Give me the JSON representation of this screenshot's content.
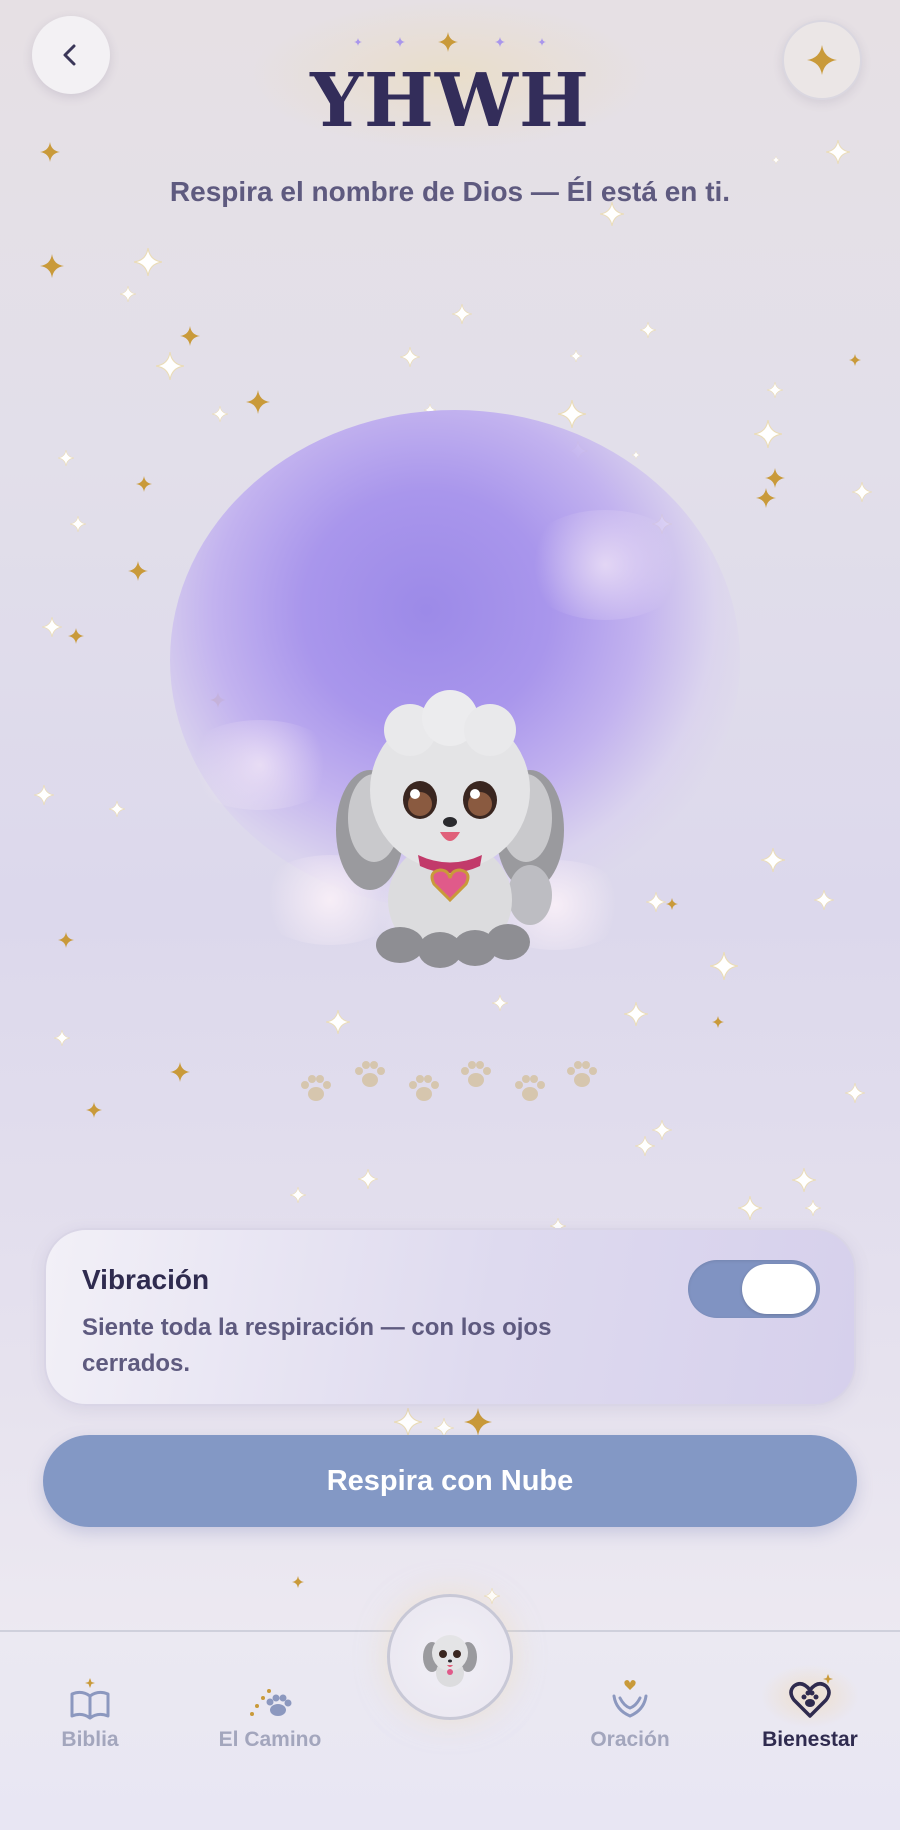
{
  "header": {
    "title": "YHWH",
    "subtitle": "Respira el nombre de Dios — Él está en ti.",
    "back_icon": "chevron-left-icon",
    "star_icon": "sparkle-icon"
  },
  "scene": {
    "mascot": "cloud-puppy-mascot",
    "paw_prints": 6
  },
  "vibration": {
    "title": "Vibración",
    "description": "Siente toda la respiración — con los ojos cerrados.",
    "enabled": true
  },
  "breathe_button": {
    "label": "Respira con Nube"
  },
  "tabbar": {
    "tabs": [
      {
        "label": "Biblia",
        "icon": "open-book-icon",
        "active": false
      },
      {
        "label": "El Camino",
        "icon": "paw-path-icon",
        "active": false
      },
      {
        "label": "",
        "icon": "puppy-avatar-icon",
        "active": false
      },
      {
        "label": "Oración",
        "icon": "praying-hands-heart-icon",
        "active": false
      },
      {
        "label": "Bienestar",
        "icon": "heart-paw-icon",
        "active": true
      }
    ]
  },
  "colors": {
    "accent": "#8398c5",
    "title": "#332d5a",
    "gold": "#c99a3a",
    "inactive_tab": "#a3a6bd"
  }
}
